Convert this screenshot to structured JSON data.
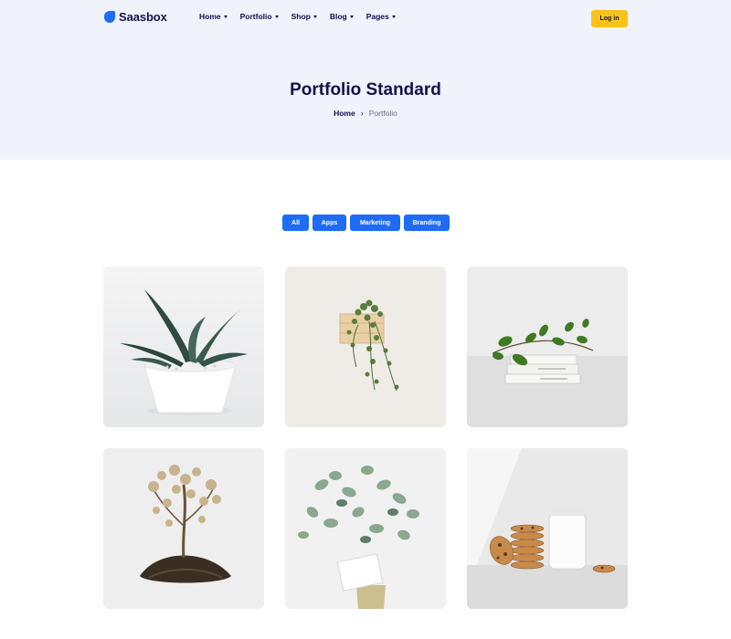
{
  "brand": {
    "name": "Saasbox"
  },
  "nav": {
    "items": [
      {
        "label": "Home"
      },
      {
        "label": "Portfolio"
      },
      {
        "label": "Shop"
      },
      {
        "label": "Blog"
      },
      {
        "label": "Pages"
      }
    ],
    "login_label": "Log in"
  },
  "hero": {
    "title": "Portfolio Standard",
    "breadcrumb": {
      "home": "Home",
      "separator": "›",
      "current": "Portfolio"
    }
  },
  "filters": [
    {
      "label": "All"
    },
    {
      "label": "Apps"
    },
    {
      "label": "Marketing"
    },
    {
      "label": "Branding"
    }
  ],
  "colors": {
    "accent": "#1e6cf5",
    "login": "#fcc21b",
    "hero_bg": "#f0f2fc",
    "heading": "#14124a"
  }
}
